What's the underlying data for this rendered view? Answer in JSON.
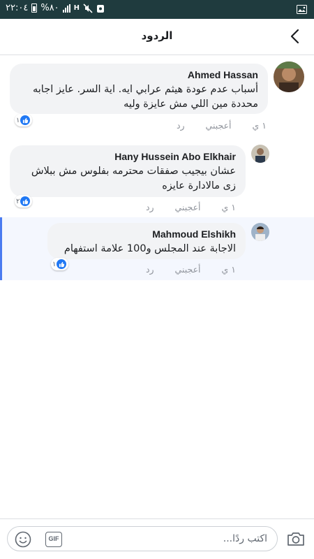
{
  "status_bar": {
    "time": "٢٢:٠٤",
    "battery": "%٨٠",
    "network": "H"
  },
  "header": {
    "title": "الردود"
  },
  "actions": {
    "like": "أعجبني",
    "reply": "رد",
    "time": "١ ي"
  },
  "comments": [
    {
      "author": "Ahmed Hassan",
      "text": "أسباب عدم عودة هيثم عرابي ايه. اية السر. عايز اجابه محددة مين اللي مش عايزة وليه",
      "likes": "١"
    },
    {
      "author": "Hany Hussein Abo Elkhair",
      "text": "عشان بيجيب صفقات محترمه بفلوس مش ببلاش زى مالادارة عايزه",
      "likes": "٢"
    },
    {
      "author": "Mahmoud Elshikh",
      "text": "الاجابة عند المجلس و100 علامة استفهام",
      "likes": "١"
    }
  ],
  "composer": {
    "placeholder": "اكتب ردًا...",
    "gif_label": "GIF"
  },
  "colors": {
    "status_bar": "#1f3b3e",
    "bubble": "#f2f3f5",
    "like_blue": "#2078f4",
    "highlight": "#f4f7fe",
    "highlight_border": "#4a7bf0"
  }
}
